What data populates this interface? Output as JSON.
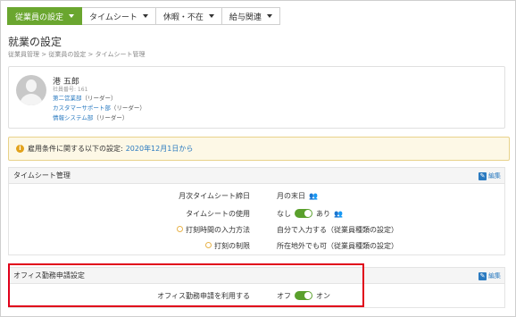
{
  "nav": {
    "tabs": [
      {
        "label": "従業員の設定",
        "active": true
      },
      {
        "label": "タイムシート",
        "active": false
      },
      {
        "label": "休暇・不在",
        "active": false
      },
      {
        "label": "給与関連",
        "active": false
      }
    ]
  },
  "page": {
    "title": "就業の設定",
    "breadcrumb": "従業員管理 > 従業員の設定 > タイムシート管理"
  },
  "employee": {
    "name": "港 五郎",
    "number": "社員番号: 161",
    "departments": [
      {
        "dept": "第二営業部",
        "role": "（リーダー）"
      },
      {
        "dept": "カスタマーサポート部",
        "role": "（リーダー）"
      },
      {
        "dept": "情報システム部",
        "role": "（リーダー）"
      }
    ]
  },
  "notice": {
    "text": "雇用条件に関する以下の設定:",
    "date": "2020年12月1日から"
  },
  "timesheet_section": {
    "title": "タイムシート管理",
    "edit_label": "編集",
    "rows": [
      {
        "label": "月次タイムシート締日",
        "value": "月の末日"
      },
      {
        "label": "タイムシートの使用",
        "off": "なし",
        "on": "あり"
      },
      {
        "label": "打刻時間の入力方法",
        "value": "自分で入力する（従業員種類の設定）"
      },
      {
        "label": "打刻の制限",
        "value": "所在地外でも可（従業員種類の設定）"
      }
    ]
  },
  "office_section": {
    "title": "オフィス勤務申請設定",
    "edit_label": "編集",
    "row": {
      "label": "オフィス勤務申請を利用する",
      "off": "オフ",
      "on": "オン"
    }
  },
  "colors": {
    "accent": "#6aa62f",
    "link": "#2a7ac0",
    "highlight": "#e0001a"
  }
}
